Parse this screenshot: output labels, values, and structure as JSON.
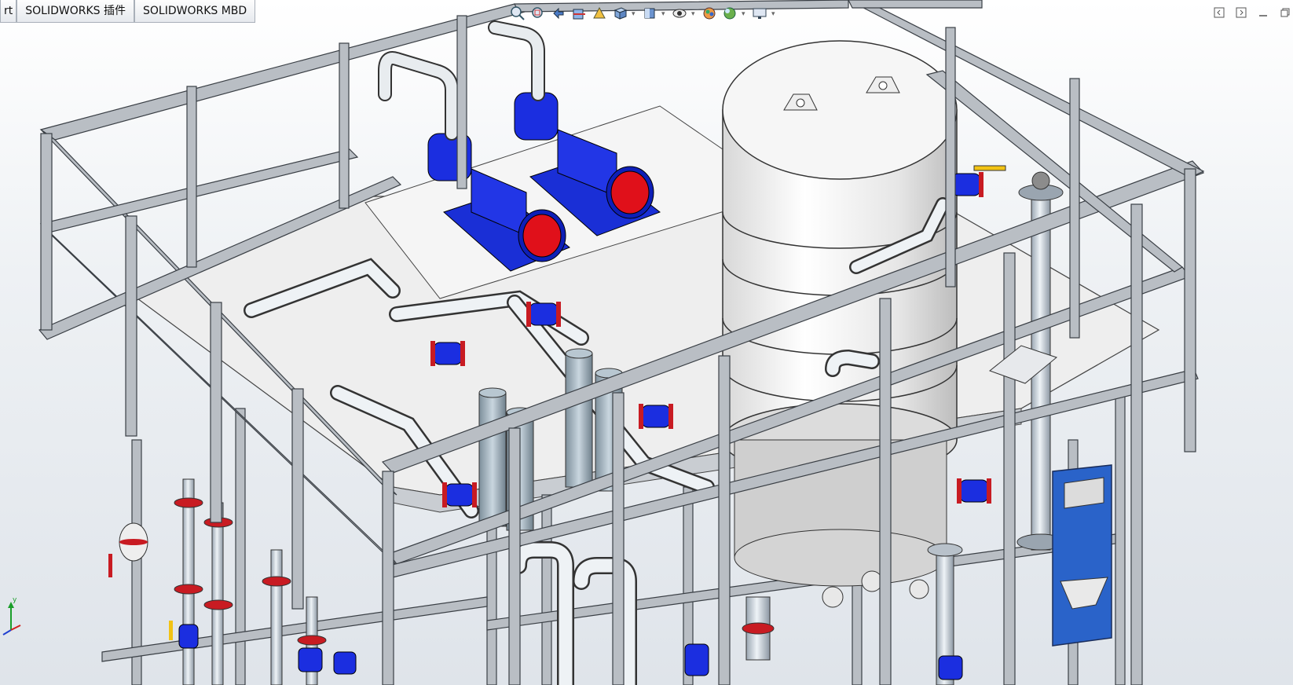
{
  "tabs": [
    {
      "label": "rt"
    },
    {
      "label": "SOLIDWORKS 插件"
    },
    {
      "label": "SOLIDWORKS MBD"
    }
  ],
  "heads_up_toolbar": {
    "icons": [
      "zoom-to-fit-icon",
      "zoom-to-area-icon",
      "previous-view-icon",
      "section-view-icon",
      "dynamic-annotation-icon",
      "view-orientation-icon",
      "display-style-icon",
      "hide-show-items-icon",
      "edit-appearance-icon",
      "apply-scene-icon",
      "view-settings-icon"
    ]
  },
  "window_controls": {
    "icons": [
      "collapse-left-icon",
      "collapse-right-icon",
      "minimize-icon",
      "restore-icon"
    ]
  },
  "colors": {
    "frame_steel": "#b9bec4",
    "frame_edge": "#3a3f45",
    "pump_blue": "#1a2fd6",
    "pump_red": "#e0101a",
    "tank_white": "#f3f3f3",
    "panel_blue": "#2a63c9",
    "valve_red": "#c81b22",
    "handle_yellow": "#f2c314"
  }
}
